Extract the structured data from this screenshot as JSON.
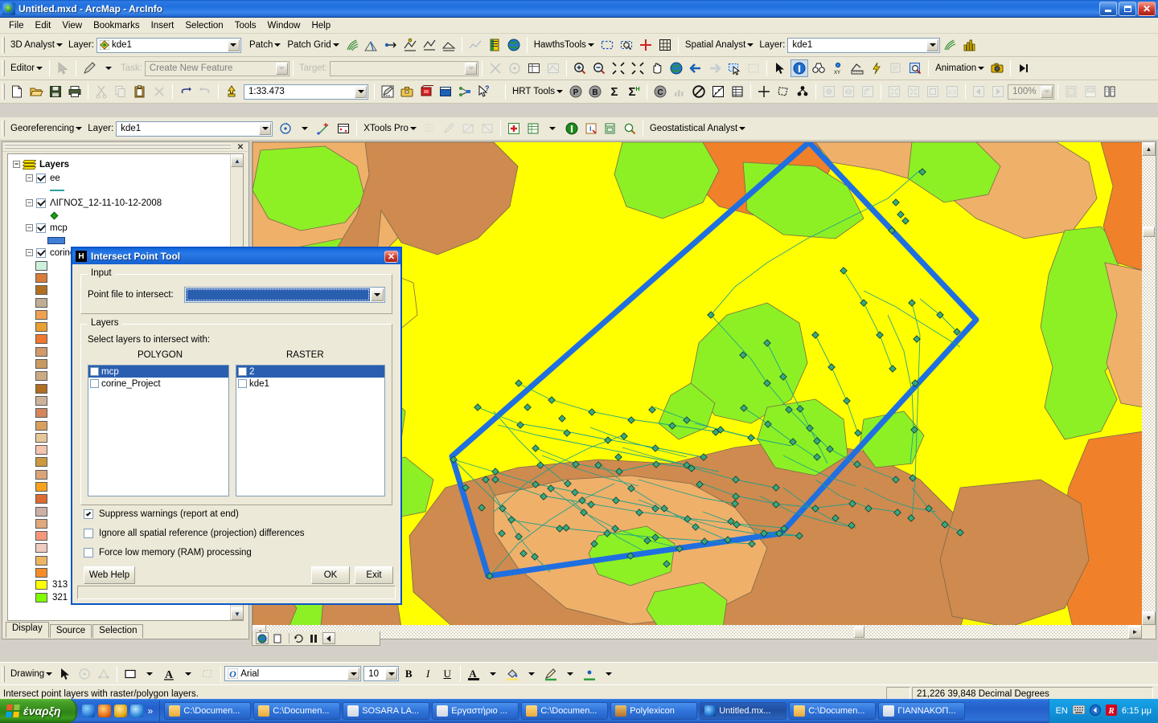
{
  "window": {
    "title": "Untitled.mxd - ArcMap - ArcInfo",
    "minimize": "_",
    "maximize": "□",
    "close": "✕"
  },
  "menu": [
    {
      "label": "File"
    },
    {
      "label": "Edit"
    },
    {
      "label": "View"
    },
    {
      "label": "Bookmarks"
    },
    {
      "label": "Insert"
    },
    {
      "label": "Selection"
    },
    {
      "label": "Tools"
    },
    {
      "label": "Window"
    },
    {
      "label": "Help"
    }
  ],
  "toolbars": {
    "analyst3d": {
      "menu_label": "3D Analyst",
      "layer_label": "Layer:",
      "layer_value": "kde1",
      "patch_label": "Patch",
      "patch_grid_label": "Patch Grid"
    },
    "hawths": {
      "menu_label": "HawthsTools"
    },
    "spatial": {
      "menu_label": "Spatial Analyst",
      "layer_label": "Layer:",
      "layer_value": "kde1"
    },
    "editor": {
      "menu_label": "Editor",
      "task_label": "Task:",
      "task_value": "Create New Feature",
      "target_label": "Target:",
      "target_value": ""
    },
    "animation": {
      "menu_label": "Animation"
    },
    "standard": {
      "scale_value": "1:33.473",
      "zoom_pct": "100%"
    },
    "hrt": {
      "menu_label": "HRT Tools"
    },
    "georef": {
      "menu_label": "Georeferencing",
      "layer_label": "Layer:",
      "layer_value": "kde1"
    },
    "xtools": {
      "menu_label": "XTools Pro"
    },
    "geostat": {
      "menu_label": "Geostatistical Analyst"
    },
    "drawing": {
      "menu_label": "Drawing",
      "font_value": "Arial",
      "size_value": "10",
      "bold": "B",
      "italic": "I",
      "underline": "U"
    }
  },
  "toc": {
    "close_label": "✕",
    "root_label": "Layers",
    "layers": [
      {
        "name": "ee",
        "checked": true,
        "symbol": "line"
      },
      {
        "name": "ΛΙΓΝΟΣ_12-11-10-12-2008",
        "checked": true,
        "symbol": "point"
      },
      {
        "name": "mcp",
        "checked": true,
        "symbol": "polygon"
      },
      {
        "name": "corine_Project",
        "checked": true,
        "symbol": "classbreaks"
      }
    ],
    "legend_swatches": [
      {
        "color": "#ccf0dd",
        "label": ""
      },
      {
        "color": "#d97c3a",
        "label": ""
      },
      {
        "color": "#b07020",
        "label": ""
      },
      {
        "color": "#c0ae92",
        "label": ""
      },
      {
        "color": "#f0a050",
        "label": ""
      },
      {
        "color": "#e8a033",
        "label": ""
      },
      {
        "color": "#f07830",
        "label": ""
      },
      {
        "color": "#d2996a",
        "label": ""
      },
      {
        "color": "#c79a62",
        "label": ""
      },
      {
        "color": "#cbab83",
        "label": ""
      },
      {
        "color": "#b06f22",
        "label": ""
      },
      {
        "color": "#ceb39b",
        "label": ""
      },
      {
        "color": "#d4855a",
        "label": ""
      },
      {
        "color": "#d8a05c",
        "label": ""
      },
      {
        "color": "#e7c79a",
        "label": ""
      },
      {
        "color": "#f3c4ae",
        "label": ""
      },
      {
        "color": "#cc9a3e",
        "label": ""
      },
      {
        "color": "#dba478",
        "label": ""
      },
      {
        "color": "#f9a21b",
        "label": ""
      },
      {
        "color": "#dd6b34",
        "label": ""
      },
      {
        "color": "#ccb0a6",
        "label": ""
      },
      {
        "color": "#e0a87c",
        "label": ""
      },
      {
        "color": "#f6977a",
        "label": ""
      },
      {
        "color": "#f0cbbf",
        "label": ""
      },
      {
        "color": "#eeb462",
        "label": ""
      },
      {
        "color": "#f58b28",
        "label": ""
      },
      {
        "color": "#ffff00",
        "label": "313"
      },
      {
        "color": "#80ff00",
        "label": "321"
      }
    ],
    "tabs": [
      {
        "label": "Display",
        "active": true
      },
      {
        "label": "Source",
        "active": false
      },
      {
        "label": "Selection",
        "active": false
      }
    ]
  },
  "dialog": {
    "title": "Intersect Point Tool",
    "title_icon": "H",
    "close_label": "✕",
    "input_group": "Input",
    "point_file_label": "Point file to intersect:",
    "point_file_value": "",
    "layers_group": "Layers",
    "select_layers_label": "Select layers to intersect with:",
    "polygon_header": "POLYGON",
    "raster_header": "RASTER",
    "polygon_items": [
      {
        "label": "mcp",
        "checked": false,
        "selected": true
      },
      {
        "label": "corine_Project",
        "checked": false,
        "selected": false
      }
    ],
    "raster_items": [
      {
        "label": "2",
        "checked": false,
        "selected": true
      },
      {
        "label": "kde1",
        "checked": false,
        "selected": false
      }
    ],
    "options": [
      {
        "label": "Suppress warnings (report at end)",
        "checked": true
      },
      {
        "label": "Ignore all spatial reference (projection) differences",
        "checked": false
      },
      {
        "label": "Force low memory (RAM) processing",
        "checked": false
      }
    ],
    "web_help_label": "Web Help",
    "ok_label": "OK",
    "exit_label": "Exit",
    "status_text": ""
  },
  "status": {
    "message": "Intersect point layers with raster/polygon layers.",
    "coordinates": "21,226  39,848 Decimal Degrees"
  },
  "taskbar": {
    "start_label": "έναρξη",
    "items": [
      {
        "label": "C:\\Documen...",
        "icon": "folder",
        "active": false
      },
      {
        "label": "C:\\Documen...",
        "icon": "folder",
        "active": false
      },
      {
        "label": "SOSARA LA...",
        "icon": "word",
        "active": false
      },
      {
        "label": "Εργαστήριο ...",
        "icon": "word",
        "active": false
      },
      {
        "label": "C:\\Documen...",
        "icon": "folder",
        "active": false
      },
      {
        "label": "Polylexicon",
        "icon": "book",
        "active": false
      },
      {
        "label": "Untitled.mx...",
        "icon": "arcmap",
        "active": true
      },
      {
        "label": "C:\\Documen...",
        "icon": "folder",
        "active": false
      },
      {
        "label": "ΓΙΑΝΝΑΚΟΠ...",
        "icon": "word",
        "active": false
      }
    ],
    "language": "EN",
    "clock": "6:15 μμ"
  },
  "map": {
    "background_color": "#ffff00",
    "mcp_color": "#1f6fe0",
    "track_color": "#1aa08a",
    "point_fill": "#3aa87f",
    "land_colors": {
      "yellow": "#ffff00",
      "green": "#8cf025",
      "tan": "#efb06a",
      "brown": "#cf8a4f",
      "orange": "#f0802a"
    }
  }
}
